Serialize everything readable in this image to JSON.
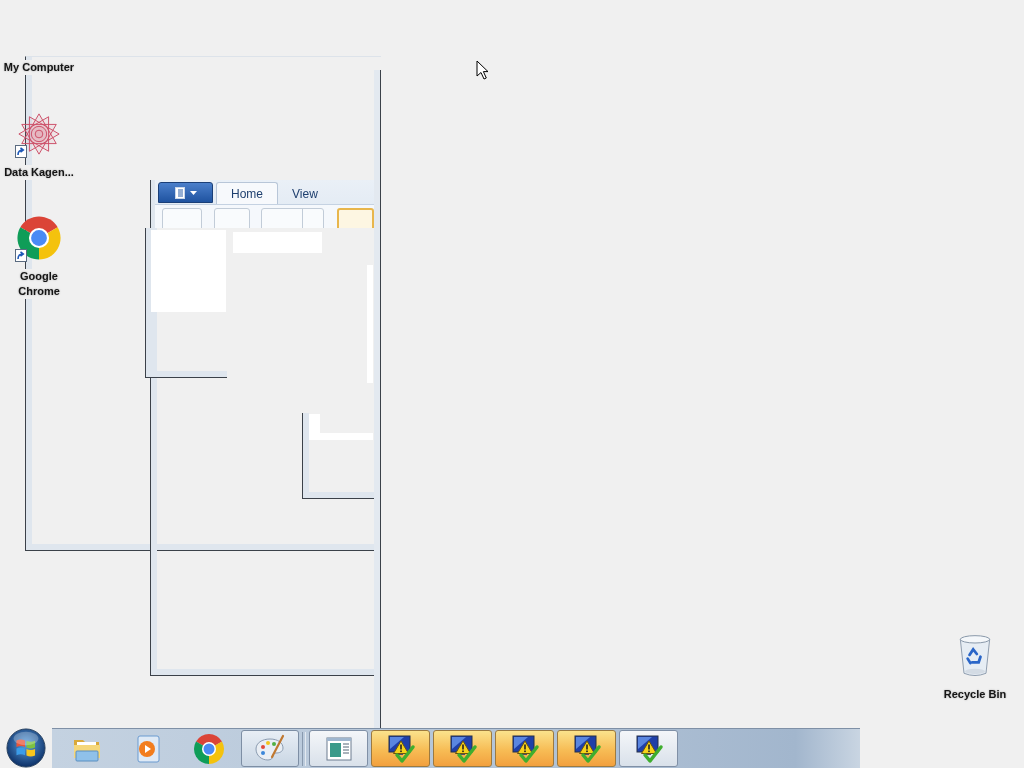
{
  "desktop": {
    "icons": [
      {
        "label": "My Computer",
        "kind": "none",
        "shortcut": false
      },
      {
        "label": "Data Kagen...",
        "kind": "star",
        "shortcut": true
      },
      {
        "label": "Google Chrome",
        "kind": "chrome",
        "shortcut": true
      },
      {
        "label": "Recycle Bin",
        "kind": "recycle",
        "shortcut": false
      }
    ]
  },
  "ribbon": {
    "tabs": [
      {
        "label": "Home",
        "selected": true
      },
      {
        "label": "View",
        "selected": false
      }
    ]
  },
  "taskbar": {
    "pinned": [
      {
        "kind": "folder",
        "running": false
      },
      {
        "kind": "media",
        "running": false
      },
      {
        "kind": "chrome",
        "running": false
      },
      {
        "kind": "paint",
        "running": true
      }
    ],
    "windows": [
      {
        "kind": "window",
        "flashing": false
      },
      {
        "kind": "alert",
        "flashing": true
      },
      {
        "kind": "alert",
        "flashing": true
      },
      {
        "kind": "alert",
        "flashing": true
      },
      {
        "kind": "alert",
        "flashing": true
      },
      {
        "kind": "alert",
        "flashing": false
      }
    ]
  }
}
